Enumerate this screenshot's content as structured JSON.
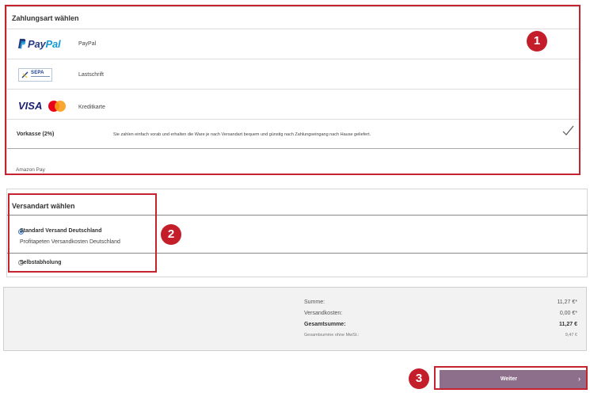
{
  "payment": {
    "title": "Zahlungsart wählen",
    "methods": [
      {
        "logo_text_1": "Pay",
        "logo_text_2": "Pal",
        "label": "PayPal",
        "icon": "paypal-logo"
      },
      {
        "logo_text": "SEPA",
        "label": "Lastschrift",
        "icon": "sepa-logo"
      },
      {
        "logo_text": "VISA",
        "label": "Kreditkarte",
        "icon": "visa-mastercard-logo"
      },
      {
        "label": "Vorkasse (2%)",
        "description": "Sie zahlen einfach vorab und erhalten die Ware je nach Versandart bequem und günstig nach Zahlungseingang nach Hause geliefert.",
        "icon": "checkmark-icon"
      },
      {
        "label": "Amazon Pay"
      }
    ]
  },
  "shipping": {
    "title": "Versandart wählen",
    "options": [
      {
        "label": "Standard Versand Deutschland",
        "sublabel": "Profitapeten Versandkosten Deutschland",
        "selected": true
      },
      {
        "label": "Selbstabholung",
        "selected": false
      }
    ]
  },
  "summary": {
    "rows": [
      {
        "label": "Summe:",
        "value": "11,27 €*"
      },
      {
        "label": "Versandkosten:",
        "value": "0,00 €*"
      },
      {
        "label": "Gesamtsumme:",
        "value": "11,27 €"
      },
      {
        "label": "Gesamtsumme ohne MwSt.:",
        "value": "9,47 €"
      }
    ]
  },
  "actions": {
    "next_label": "Weiter",
    "next_icon": "chevron-right-icon"
  },
  "annotations": {
    "markers": [
      "1",
      "2",
      "3"
    ],
    "color": "#c4232f"
  },
  "colors": {
    "button": "#8e6f8b",
    "paypal_dark": "#253b80",
    "paypal_light": "#179bd7",
    "visa": "#1a1f71",
    "radio_selected": "#3a78c3"
  }
}
